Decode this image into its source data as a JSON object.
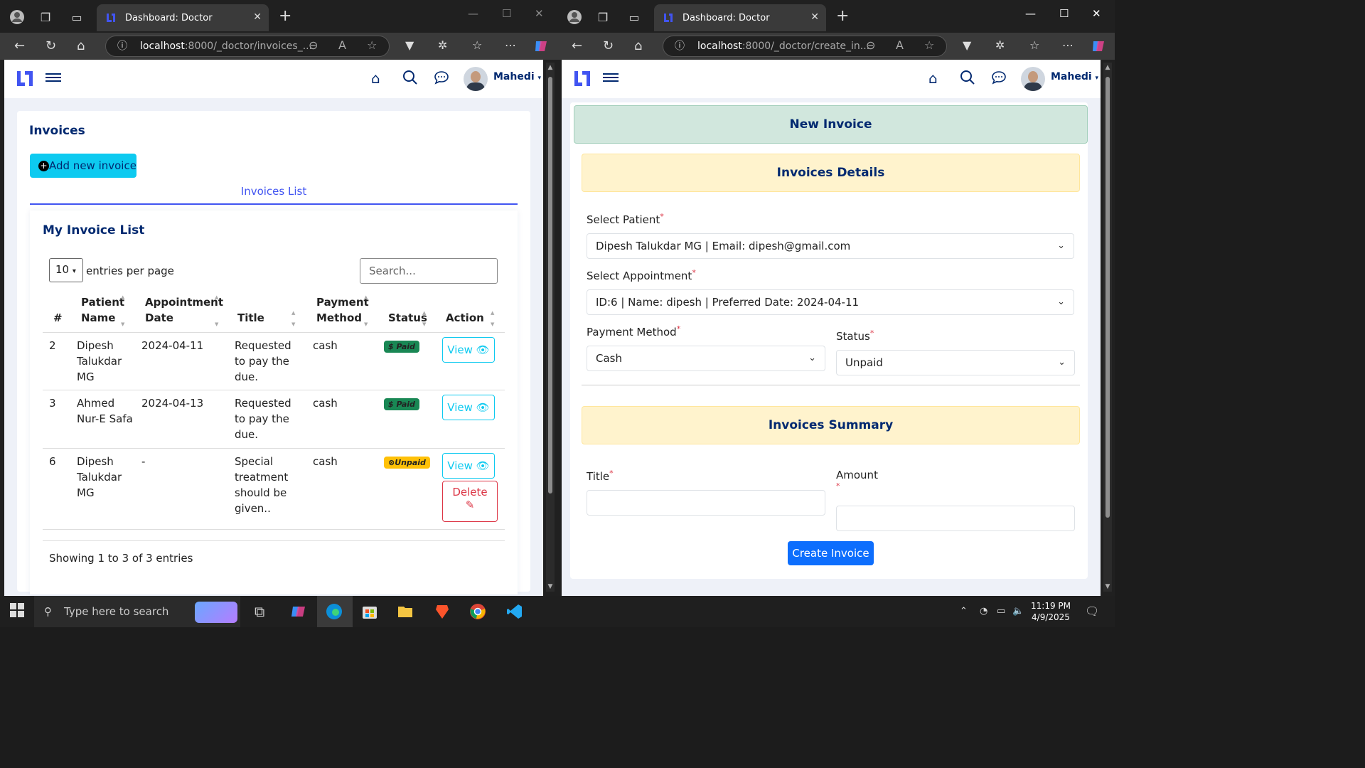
{
  "left_window": {
    "tab_title": "Dashboard: Doctor",
    "url_host": "localhost",
    "url_path": ":8000/_doctor/invoices_...",
    "user_name": "Mahedi",
    "page_title": "Invoices",
    "add_button": "Add new invoice",
    "tab_label": "Invoices List",
    "list_title": "My Invoice List",
    "entries_value": "10",
    "entries_label": "entries per page",
    "search_placeholder": "Search...",
    "columns": {
      "num": "#",
      "patient_l1": "Patient",
      "patient_l2": "Name",
      "appt_l1": "Appointment",
      "appt_l2": "Date",
      "title": "Title",
      "pay_l1": "Payment",
      "pay_l2": "Method",
      "status": "Status",
      "action": "Action"
    },
    "rows": [
      {
        "num": "2",
        "name_l1": "Dipesh",
        "name_l2": "Talukdar",
        "name_l3": "MG",
        "date": "2024-04-11",
        "title_l1": "Requested",
        "title_l2": "to pay the",
        "title_l3": "due.",
        "title_l4": "",
        "method": "cash",
        "status": "$ Paid",
        "view": "View",
        "delete": ""
      },
      {
        "num": "3",
        "name_l1": "Ahmed",
        "name_l2": "Nur-E Safa",
        "name_l3": "",
        "date": "2024-04-13",
        "title_l1": "Requested",
        "title_l2": "to pay the",
        "title_l3": "due.",
        "title_l4": "",
        "method": "cash",
        "status": "$ Paid",
        "view": "View",
        "delete": ""
      },
      {
        "num": "6",
        "name_l1": "Dipesh",
        "name_l2": "Talukdar",
        "name_l3": "MG",
        "date": "-",
        "title_l1": "Special",
        "title_l2": "treatment",
        "title_l3": "should be",
        "title_l4": "given..",
        "method": "cash",
        "status": "⊗Unpaid",
        "view": "View",
        "delete": "Delete"
      }
    ],
    "footer": "Showing 1 to 3 of 3 entries"
  },
  "right_window": {
    "tab_title": "Dashboard: Doctor",
    "url_host": "localhost",
    "url_path": ":8000/_doctor/create_in...",
    "user_name": "Mahedi",
    "header_title": "New Invoice",
    "details_title": "Invoices Details",
    "patient_label": "Select Patient",
    "patient_value": "Dipesh Talukdar MG | Email: dipesh@gmail.com",
    "appointment_label": "Select Appointment",
    "appointment_value": "ID:6 | Name: dipesh | Preferred Date: 2024-04-11",
    "payment_label": "Payment Method",
    "payment_value": "Cash",
    "status_label": "Status",
    "status_value": "Unpaid",
    "summary_title": "Invoices Summary",
    "title_label": "Title",
    "amount_label": "Amount",
    "submit": "Create Invoice",
    "required_mark": "*"
  },
  "taskbar": {
    "search_placeholder": "Type here to search",
    "time": "11:19 PM",
    "date": "4/9/2025"
  },
  "colors": {
    "brand_navy": "#012970",
    "accent_blue": "#4154f1",
    "info": "#0dcaf0",
    "success": "#198754",
    "warning": "#ffc107",
    "danger": "#dc3545",
    "primary": "#0d6efd"
  }
}
